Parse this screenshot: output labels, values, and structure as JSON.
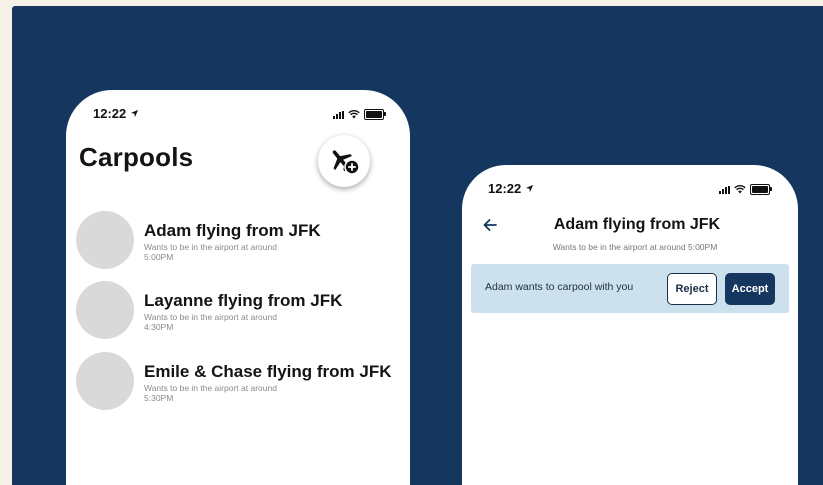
{
  "colors": {
    "panel": "#15365e",
    "accent": "#15365e",
    "banner": "#cde0ee",
    "avatar": "#d9d9d9"
  },
  "carpools_screen": {
    "status_time": "12:22",
    "title": "Carpools",
    "add_button_icon": "airplane-add-icon",
    "items": [
      {
        "title": "Adam flying from JFK",
        "subtitle": "Wants to be in the airport at around 5:00PM"
      },
      {
        "title": "Layanne flying from JFK",
        "subtitle": "Wants to be in the airport at around 4:30PM"
      },
      {
        "title": "Emile & Chase flying from JFK",
        "subtitle": "Wants to be in the airport at around 5:30PM"
      }
    ]
  },
  "detail_screen": {
    "status_time": "12:22",
    "title": "Adam flying from JFK",
    "subtitle": "Wants to be in the airport at around 5:00PM",
    "request": {
      "message": "Adam wants to carpool with you",
      "reject_label": "Reject",
      "accept_label": "Accept"
    }
  }
}
